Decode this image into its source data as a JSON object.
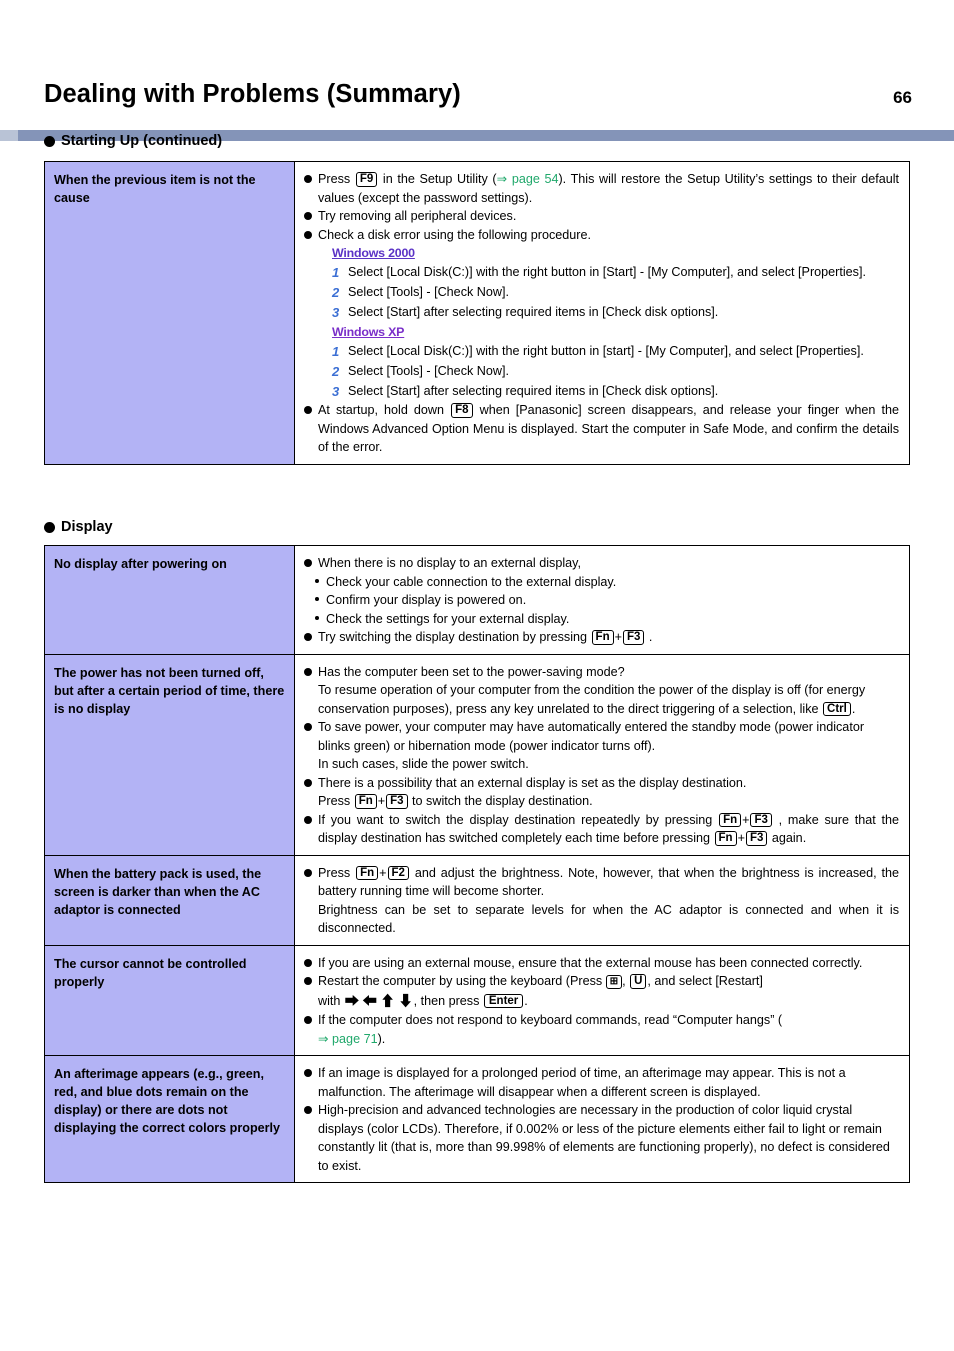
{
  "header": {
    "title": "Dealing with Problems (Summary)",
    "page_number": "66"
  },
  "sections": [
    {
      "heading": "Starting Up (continued)",
      "rows": [
        {
          "label": "When the previous item is not the cause",
          "b1_pre": "Press",
          "b1_key": "F9",
          "b1_mid": "in the Setup Utility (",
          "b1_link": "⇒ page 54",
          "b1_post": "). This will restore the Setup Utility’s settings to their default values (except the password settings).",
          "b2": "Try removing all peripheral devices.",
          "b3": "Check a disk error using the following procedure.",
          "os1": "Windows 2000",
          "os1_steps": [
            {
              "n": "1",
              "t": "Select [Local Disk(C:)] with the right button in [Start] - [My Computer], and select  [Properties]."
            },
            {
              "n": "2",
              "t": "Select [Tools] - [Check Now]."
            },
            {
              "n": "3",
              "t": "Select [Start] after selecting required items in [Check disk options]."
            }
          ],
          "os2": "Windows XP",
          "os2_steps": [
            {
              "n": "1",
              "t": "Select [Local Disk(C:)] with the right button in [start] - [My Computer], and select  [Properties]."
            },
            {
              "n": "2",
              "t": "Select [Tools] - [Check Now]."
            },
            {
              "n": "3",
              "t": "Select [Start] after selecting required items in [Check disk options]."
            }
          ],
          "b4_pre": "At startup, hold down",
          "b4_key": "F8",
          "b4_post": "when [Panasonic] screen disappears, and release your finger when the Windows Advanced Option Menu is displayed. Start the computer in Safe Mode, and confirm the details of the error."
        }
      ]
    },
    {
      "heading": "Display",
      "rows": [
        {
          "label": "No display after powering on",
          "b1": "When there is no display to an external display,",
          "subs": [
            "Check your cable connection to the external display.",
            "Confirm your display is powered on.",
            "Check the settings for your external display."
          ],
          "b2_pre": "Try switching the display destination by pressing",
          "b2_key1": "Fn",
          "b2_plus": "+",
          "b2_key2": "F3",
          "b2_post": "."
        },
        {
          "label": "The power has not been turned off, but after a certain period of time, there is no display",
          "b1": "Has the computer been set to the power-saving mode?",
          "b1_cont_pre": "To resume operation of your computer from the condition the power of the display is off (for energy conservation purposes), press any key unrelated to the direct triggering of a selection, like",
          "b1_key": "Ctrl",
          "b1_cont_post": ".",
          "b2": "To save power, your computer may have automatically entered the standby mode (power indicator blinks green) or hibernation mode (power indicator turns off).",
          "b2_cont": "In such cases, slide the power switch.",
          "b3": "There is a possibility that an external display is set as the display destination.",
          "b3_pre": "Press",
          "b3_key1": "Fn",
          "b3_plus": "+",
          "b3_key2": "F3",
          "b3_post": "to switch the display destination.",
          "b4_pre": "If you want to switch the display destination repeatedly by pressing",
          "b4_key1": "Fn",
          "b4_plus": "+",
          "b4_key2": "F3",
          "b4_mid": ", make sure that the display destination has switched completely each time before pressing",
          "b4_key3": "Fn",
          "b4_plus2": "+",
          "b4_key4": "F3",
          "b4_post": "again."
        },
        {
          "label": "When the battery pack is used, the screen is darker than when the AC adaptor is connected",
          "b1_pre": "Press",
          "b1_key1": "Fn",
          "b1_plus": "+",
          "b1_key2": "F2",
          "b1_post": "and adjust the brightness. Note, however, that when the brightness is increased, the battery running time will become shorter.",
          "b1_cont": "Brightness can be set to separate levels for when the AC adaptor is connected and when it is disconnected."
        },
        {
          "label": "The cursor cannot be controlled properly",
          "b1": "If you are using an external mouse, ensure that the external mouse has been connected correctly.",
          "b2_pre": "Restart the computer by using the keyboard (Press",
          "b2_key_win": "⊞",
          "b2_comma": ",",
          "b2_key_u": "U",
          "b2_mid": ", and select [Restart]",
          "b2_with": "with",
          "b2_arrows": "⮕ ⬅ ⬆ ⬇",
          "b2_then": ", then press",
          "b2_key_enter": "Enter",
          "b2_post": ".",
          "b3_pre": "If the computer does not respond to keyboard commands, read “Computer hangs” (",
          "b3_link": "⇒ page 71",
          "b3_post": ")."
        },
        {
          "label": "An afterimage appears (e.g., green, red, and blue dots remain on the display) or there are dots not displaying the correct colors properly",
          "b1": "If an image is displayed for a prolonged period of time, an afterimage may appear. This is not a malfunction. The afterimage will disappear when a different screen is displayed.",
          "b2": "High-precision and advanced technologies are necessary in the production of color liquid crystal displays (color LCDs). Therefore, if 0.002% or less of the picture elements either fail to light or remain constantly lit (that is, more than 99.998% of elements are functioning properly), no defect is considered to exist."
        }
      ]
    }
  ]
}
